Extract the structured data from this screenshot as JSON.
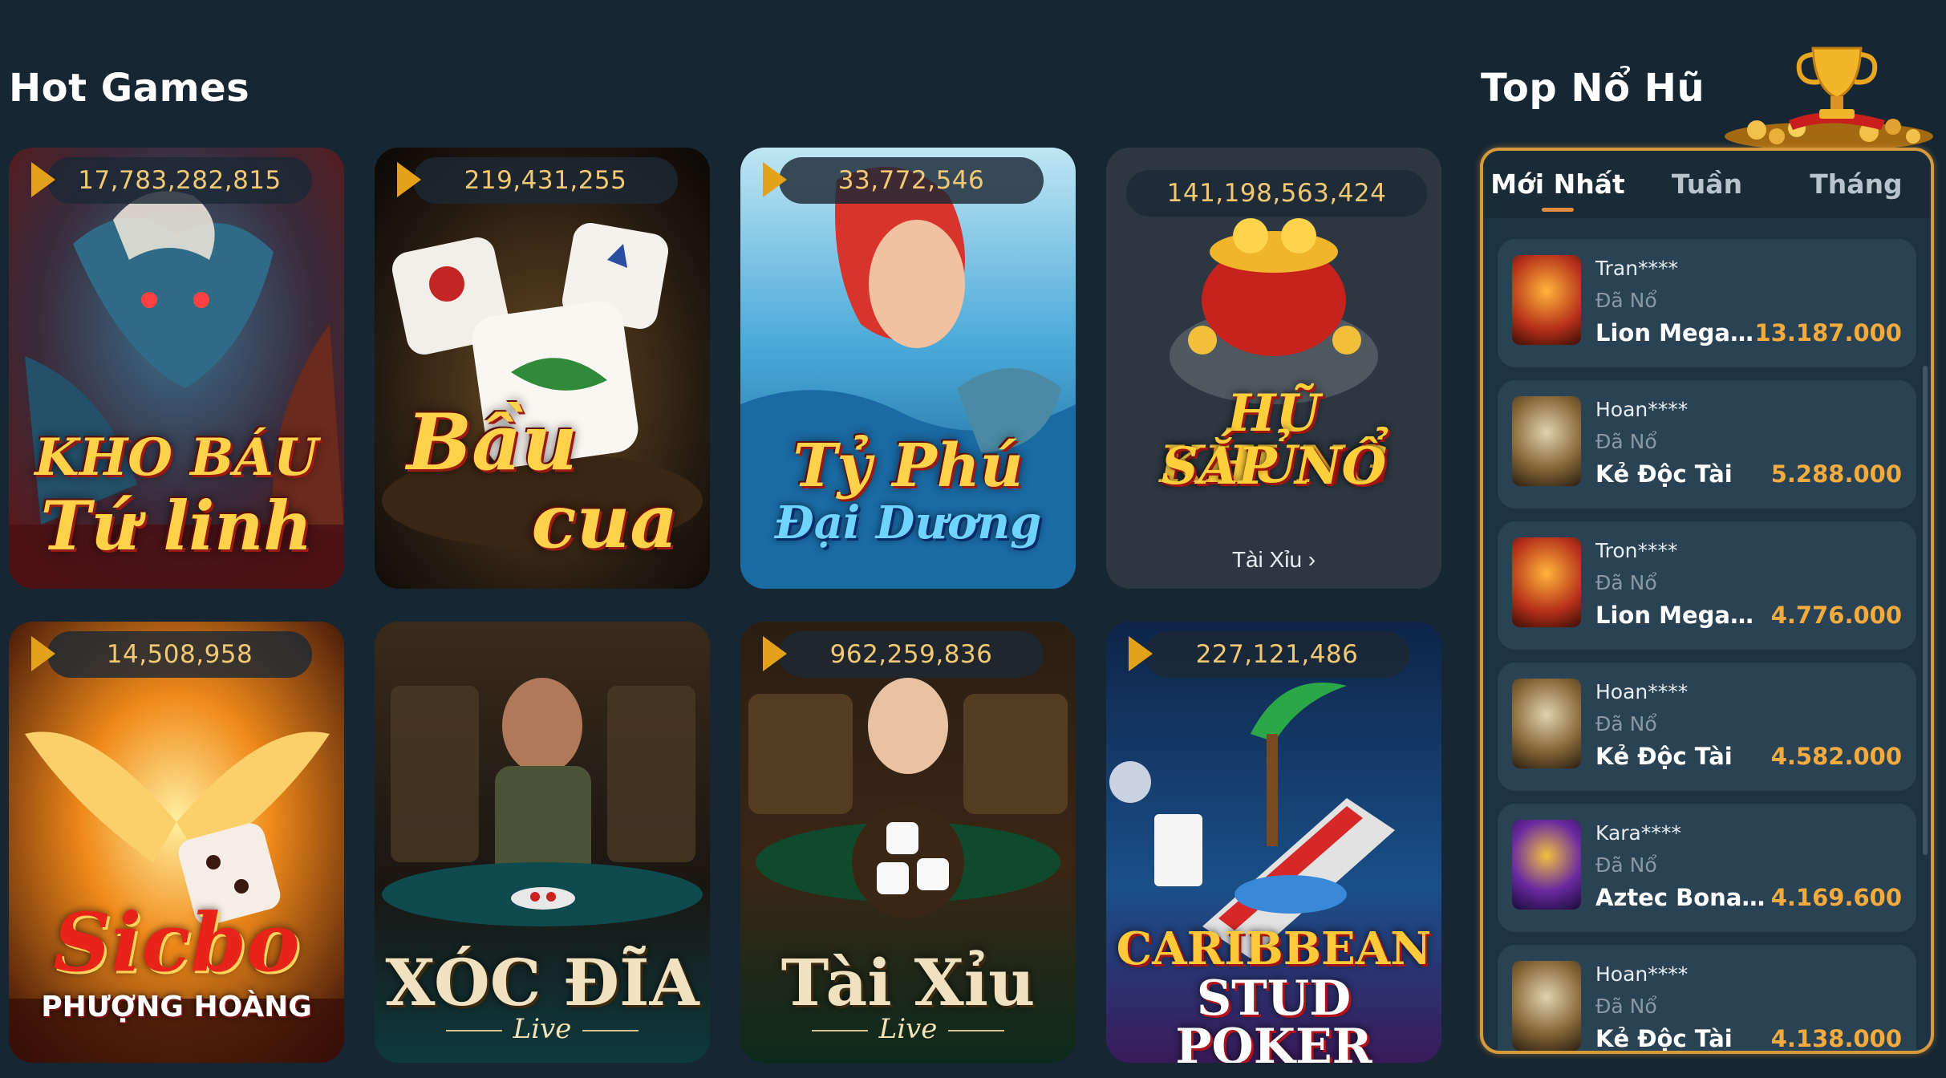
{
  "hot_games": {
    "title": "Hot Games",
    "cards": [
      {
        "jackpot": "17,783,282,815",
        "title_line1": "KHO BÁU",
        "title_line2": "Tứ linh"
      },
      {
        "jackpot": "219,431,255",
        "title_line1": "Bầu",
        "title_line2": "cua"
      },
      {
        "jackpot": "33,772,546",
        "title_line1": "Tỷ Phú",
        "title_line2": "Đại Dương"
      },
      {
        "jackpot": "141,198,563,424",
        "title_line1": "HŨ KHỦNG",
        "title_line2": "SẮP NỔ",
        "link": "Tài Xỉu ›"
      },
      {
        "jackpot": "14,508,958",
        "title_line1": "Sicbo",
        "title_line2": "PHƯỢNG HOÀNG"
      },
      {
        "jackpot": "",
        "title_line1": "XÓC ĐĨA",
        "title_line2": "Live"
      },
      {
        "jackpot": "962,259,836",
        "title_line1": "Tài Xỉu",
        "title_line2": "Live"
      },
      {
        "jackpot": "227,121,486",
        "title_line1": "CARIBBEAN",
        "title_line2": "STUD POKER"
      }
    ]
  },
  "top_no_hu": {
    "title": "Top Nổ Hũ",
    "tabs": [
      "Mới Nhất",
      "Tuần",
      "Tháng"
    ],
    "active_tab": "Mới Nhất",
    "status_label": "Đã Nổ",
    "entries": [
      {
        "user": "Tran****",
        "game": "Lion Megawa...",
        "amount": "13.187.000",
        "thumb": "lion-megaways-icon"
      },
      {
        "user": "Hoan****",
        "game": "Kẻ Độc Tài",
        "amount": "5.288.000",
        "thumb": "ke-doc-tai-icon"
      },
      {
        "user": "Tron****",
        "game": "Lion Megaways",
        "amount": "4.776.000",
        "thumb": "lion-megaways-icon"
      },
      {
        "user": "Hoan****",
        "game": "Kẻ Độc Tài",
        "amount": "4.582.000",
        "thumb": "ke-doc-tai-icon"
      },
      {
        "user": "Kara****",
        "game": "Aztec Bonanza",
        "amount": "4.169.600",
        "thumb": "aztec-bonanza-icon"
      },
      {
        "user": "Hoan****",
        "game": "Kẻ Độc Tài",
        "amount": "4.138.000",
        "thumb": "ke-doc-tai-icon"
      }
    ]
  },
  "colors": {
    "background": "#172633",
    "jackpot_text": "#f3c873",
    "amount_text": "#f3ab3e",
    "panel_border": "#d79a3a",
    "tab_indicator": "#e58a3c"
  }
}
